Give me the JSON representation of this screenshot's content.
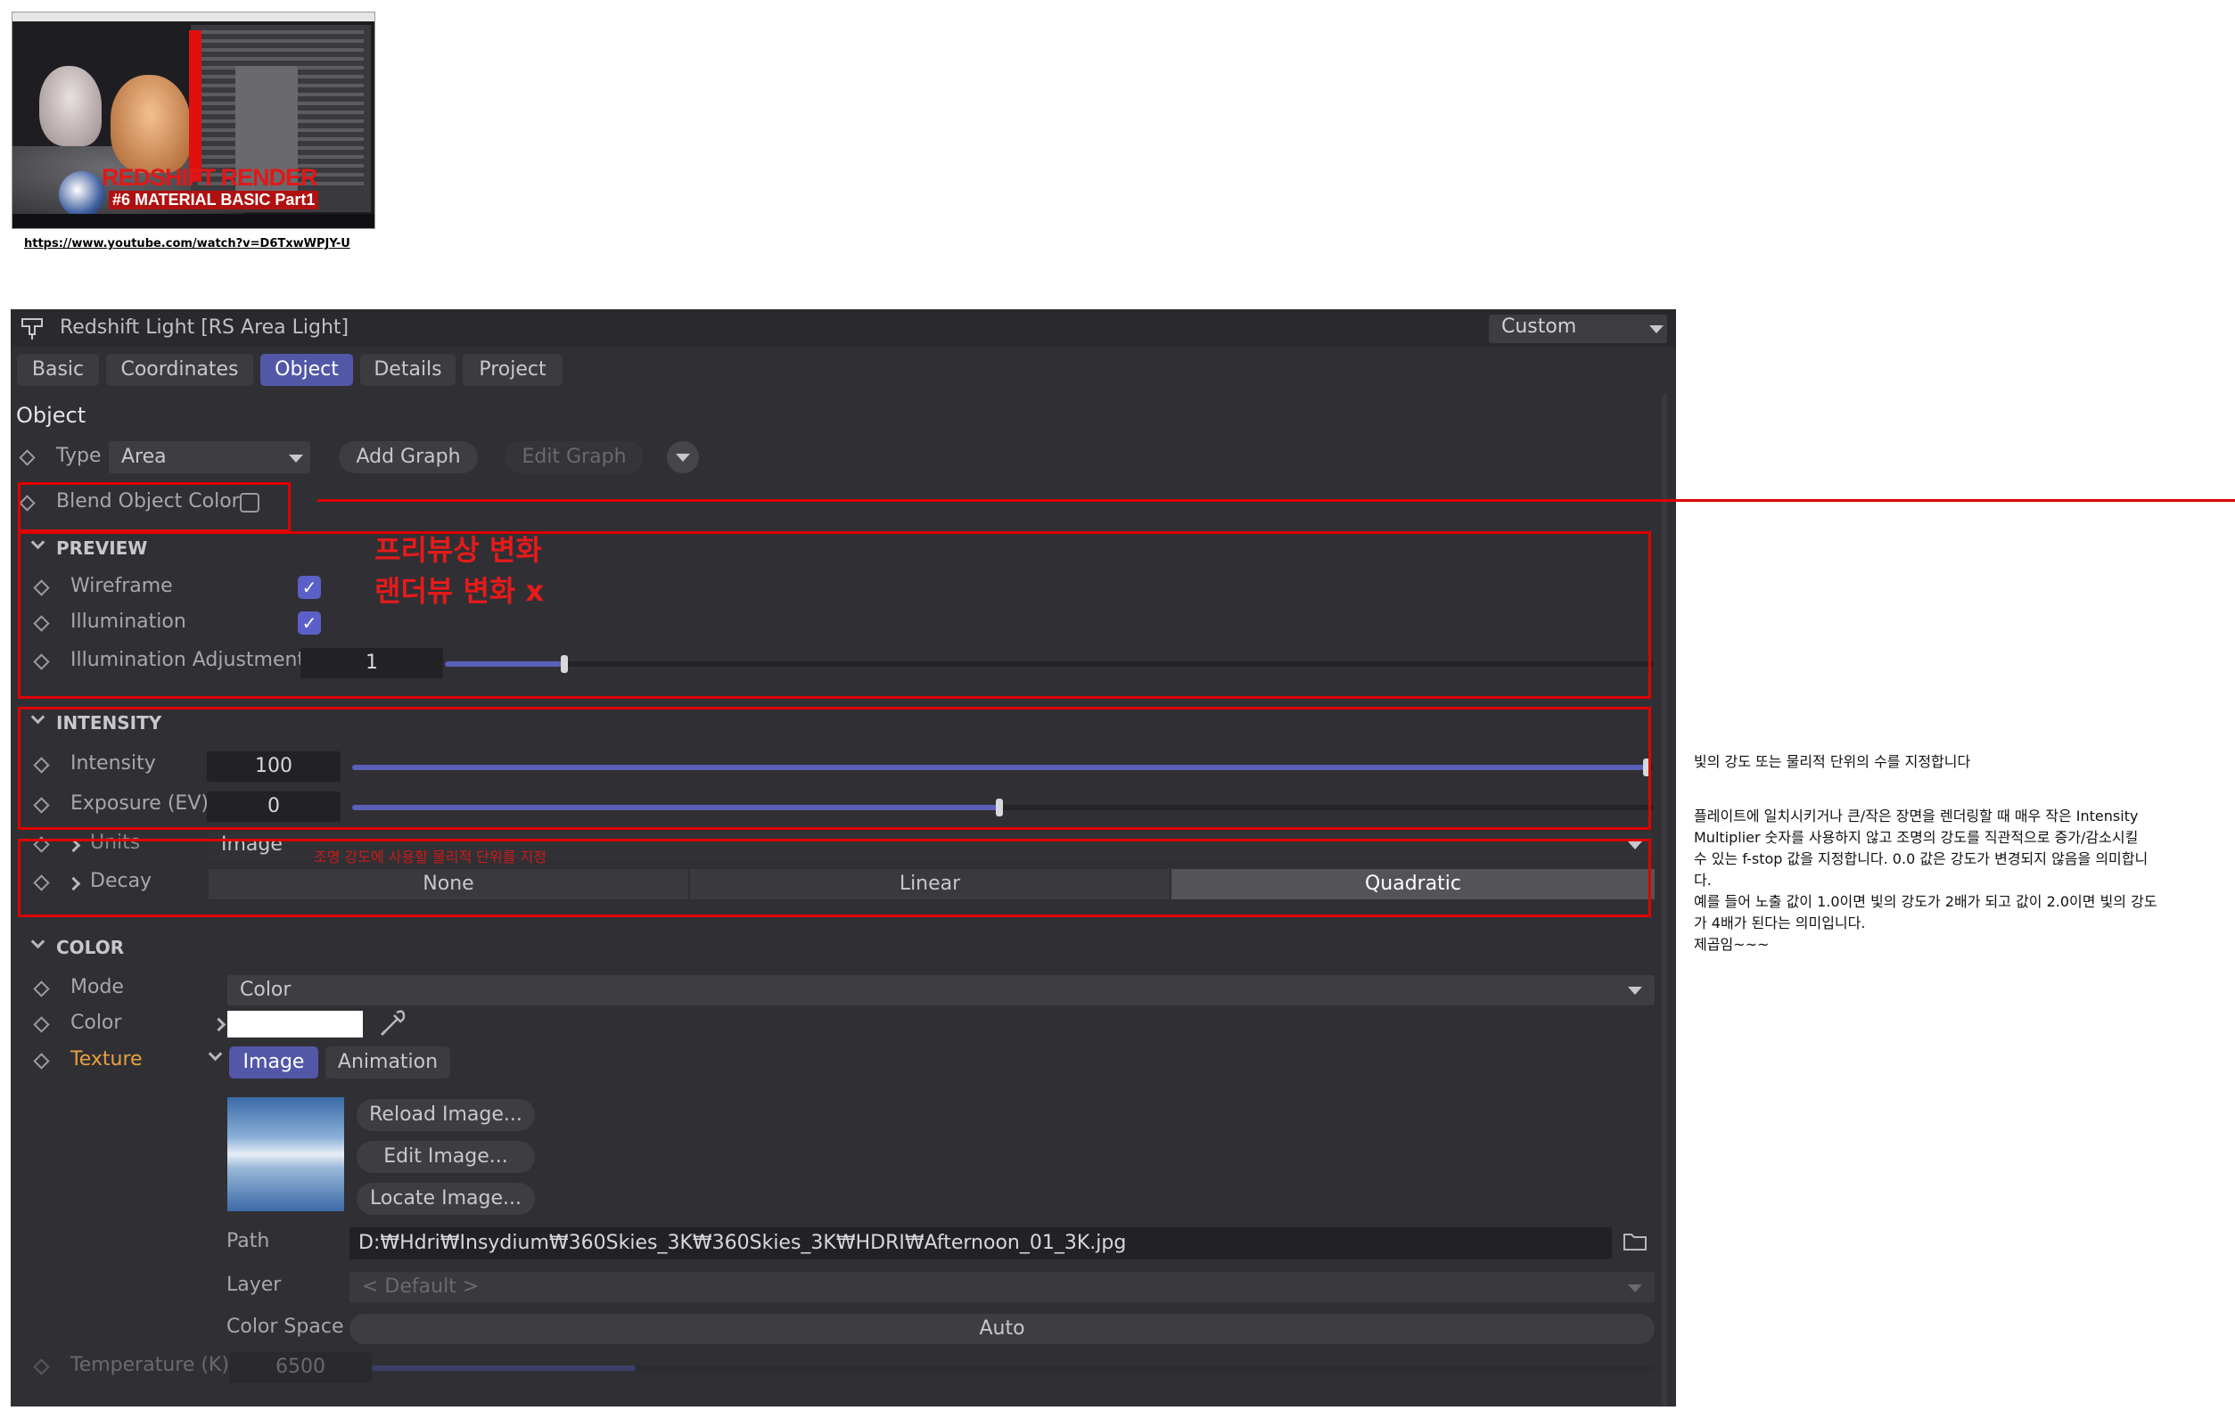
{
  "thumbnail": {
    "headline": "REDSHIFT RENDER",
    "subline": "#6 MATERIAL BASIC Part1",
    "link": "https://www.youtube.com/watch?v=D6TxwWPJY-U"
  },
  "panel": {
    "title": "Redshift Light [RS Area Light]",
    "preset": "Custom",
    "tabs": [
      {
        "label": "Basic",
        "active": false
      },
      {
        "label": "Coordinates",
        "active": false
      },
      {
        "label": "Object",
        "active": true
      },
      {
        "label": "Details",
        "active": false
      },
      {
        "label": "Project",
        "active": false
      }
    ],
    "section_title": "Object",
    "type": {
      "label": "Type",
      "value": "Area"
    },
    "add_graph": "Add Graph",
    "edit_graph": "Edit Graph",
    "blend_object_color": {
      "label": "Blend Object Color",
      "checked": false
    },
    "preview": {
      "header": "PREVIEW",
      "wireframe": {
        "label": "Wireframe",
        "checked": true
      },
      "illumination": {
        "label": "Illumination",
        "checked": true
      },
      "illumination_adjustment": {
        "label": "Illumination Adjustment",
        "value": "1",
        "slider_fraction": 0.1
      }
    },
    "intensity": {
      "header": "INTENSITY",
      "intensity": {
        "label": "Intensity",
        "value": "100",
        "slider_fraction": 1.0
      },
      "exposure": {
        "label": "Exposure (EV)",
        "value": "0",
        "slider_fraction": 0.5
      },
      "units": {
        "label": "Units",
        "value": "Image"
      },
      "decay": {
        "label": "Decay",
        "options": [
          "None",
          "Linear",
          "Quadratic"
        ],
        "selected": "Quadratic"
      }
    },
    "color": {
      "header": "COLOR",
      "mode": {
        "label": "Mode",
        "value": "Color"
      },
      "color": {
        "label": "Color",
        "swatch": "#ffffff"
      },
      "texture": {
        "label": "Texture",
        "tabs": [
          "Image",
          "Animation"
        ],
        "active_tab": "Image"
      },
      "buttons": [
        "Reload Image...",
        "Edit Image...",
        "Locate Image..."
      ],
      "path": {
        "label": "Path",
        "value": "D:₩Hdri₩Insydium₩360Skies_3K₩360Skies_3K₩HDRI₩Afternoon_01_3K.jpg"
      },
      "layer": {
        "label": "Layer",
        "value": "< Default >"
      },
      "color_space": {
        "label": "Color Space",
        "value": "Auto"
      },
      "temperature": {
        "label": "Temperature (K)",
        "value": "6500",
        "slider_fraction": 0.2
      }
    }
  },
  "annotations": {
    "preview_note_line1": "프리뷰상 변화",
    "preview_note_line2": "랜더뷰 변화 x",
    "units_note": "조명 강도에 사용할 물리적 단위를 지정"
  },
  "side_notes": {
    "line1": "빛의 강도 또는 물리적 단위의 수를 지정합니다",
    "paragraph": [
      "플레이트에 일치시키거나 큰/작은 장면을 렌더링할 때 매우 작은 Intensity",
      "Multiplier 숫자를 사용하지 않고 조명의 강도를 직관적으로 증가/감소시킬",
      "수 있는 f-stop 값을 지정합니다. 0.0 값은 강도가 변경되지 않음을 의미합니",
      "다.",
      "예를 들어 노출 값이 1.0이면 빛의 강도가 2배가 되고 값이 2.0이면 빛의 강도",
      "가 4배가 된다는 의미입니다.",
      "제곱임~~~"
    ]
  },
  "colors": {
    "accent": "#5a60c8",
    "panel_bg": "#303034",
    "annotation_red": "#e00000",
    "texture_label": "#e8a040"
  }
}
